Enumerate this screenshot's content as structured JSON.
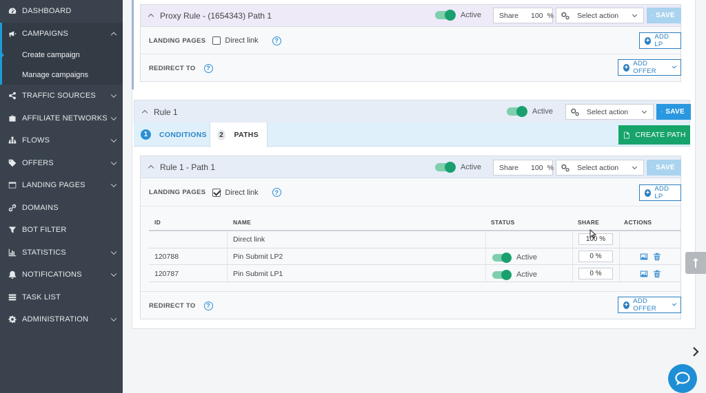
{
  "sidebar": {
    "items": [
      {
        "label": "DASHBOARD",
        "icon": "dashboard-icon",
        "chevron": false
      },
      {
        "label": "CAMPAIGNS",
        "icon": "megaphone-icon",
        "chevron": true
      },
      {
        "label": "TRAFFIC SOURCES",
        "icon": "share-icon",
        "chevron": true
      },
      {
        "label": "AFFILIATE NETWORKS",
        "icon": "briefcase-icon",
        "chevron": true
      },
      {
        "label": "FLOWS",
        "icon": "sitemap-icon",
        "chevron": true
      },
      {
        "label": "OFFERS",
        "icon": "tag-icon",
        "chevron": true
      },
      {
        "label": "LANDING PAGES",
        "icon": "window-icon",
        "chevron": true
      },
      {
        "label": "DOMAINS",
        "icon": "link-icon",
        "chevron": false
      },
      {
        "label": "BOT FILTER",
        "icon": "filter-icon",
        "chevron": false
      },
      {
        "label": "STATISTICS",
        "icon": "bar-chart-icon",
        "chevron": true
      },
      {
        "label": "NOTIFICATIONS",
        "icon": "bell-icon",
        "chevron": true
      },
      {
        "label": "TASK LIST",
        "icon": "list-icon",
        "chevron": false
      },
      {
        "label": "ADMINISTRATION",
        "icon": "gear-icon",
        "chevron": true
      }
    ],
    "campaign_sub": [
      "Create campaign",
      "Manage campaigns"
    ]
  },
  "proxy_path": {
    "title": "Proxy Rule - (1654343) Path 1",
    "active_label": "Active",
    "share_label": "Share",
    "share_value": "100",
    "share_unit": "%",
    "select_placeholder": "Select action",
    "save_label": "SAVE",
    "landing_pages_label": "LANDING PAGES",
    "direct_link_label": "Direct link",
    "direct_link_checked": false,
    "add_lp_label": "ADD LP",
    "redirect_label": "REDIRECT TO",
    "add_offer_label": "ADD OFFER"
  },
  "rule": {
    "title": "Rule 1",
    "active_label": "Active",
    "select_placeholder": "Select action",
    "save_label": "SAVE",
    "tabs": [
      {
        "num": "1",
        "label": "CONDITIONS"
      },
      {
        "num": "2",
        "label": "PATHS"
      }
    ],
    "create_path_label": "CREATE PATH"
  },
  "rule_path": {
    "title": "Rule 1 - Path 1",
    "active_label": "Active",
    "share_label": "Share",
    "share_value": "100",
    "share_unit": "%",
    "select_placeholder": "Select action",
    "save_label": "SAVE",
    "landing_pages_label": "LANDING PAGES",
    "direct_link_label": "Direct link",
    "direct_link_checked": true,
    "add_lp_label": "ADD LP",
    "redirect_label": "REDIRECT TO",
    "add_offer_label": "ADD OFFER",
    "table": {
      "headers": {
        "id": "ID",
        "name": "NAME",
        "status": "STATUS",
        "share": "SHARE",
        "actions": "ACTIONS"
      },
      "rows": [
        {
          "id": "",
          "name": "Direct link",
          "status": "",
          "share": "100 %"
        },
        {
          "id": "120788",
          "name": "Pin Submit LP2",
          "status": "Active",
          "share": "0 %"
        },
        {
          "id": "120787",
          "name": "Pin Submit LP1",
          "status": "Active",
          "share": "0 %"
        }
      ]
    }
  },
  "colors": {
    "sidebar_bg": "#3a434d",
    "accent_blue": "#2a98e0",
    "toggle_green": "#1aa06e",
    "create_green": "#17a46b"
  }
}
